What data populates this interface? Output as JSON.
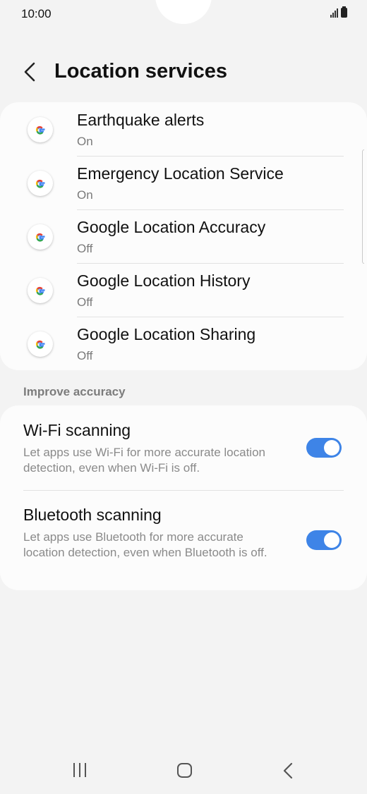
{
  "status_bar": {
    "time": "10:00"
  },
  "header": {
    "title": "Location services"
  },
  "services": [
    {
      "title": "Earthquake alerts",
      "status": "On"
    },
    {
      "title": "Emergency Location Service",
      "status": "On"
    },
    {
      "title": "Google Location Accuracy",
      "status": "Off"
    },
    {
      "title": "Google Location History",
      "status": "Off"
    },
    {
      "title": "Google Location Sharing",
      "status": "Off"
    }
  ],
  "improve": {
    "section_label": "Improve accuracy",
    "wifi": {
      "title": "Wi-Fi scanning",
      "description": "Let apps use Wi-Fi for more accurate location detection, even when Wi-Fi is off.",
      "enabled": true
    },
    "bluetooth": {
      "title": "Bluetooth scanning",
      "description": "Let apps use Bluetooth for more accurate location detection, even when Bluetooth is off.",
      "enabled": true
    }
  },
  "colors": {
    "accent": "#3e84e7",
    "background": "#f3f3f3"
  },
  "icons": {
    "service": "google-g-icon",
    "back": "back-arrow-icon"
  }
}
